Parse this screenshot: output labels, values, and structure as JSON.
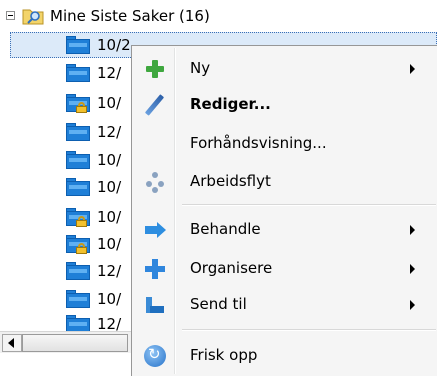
{
  "tree": {
    "root_label": "Mine Siste Saker (16)",
    "rows": [
      {
        "label": "10/2",
        "locked": false,
        "selected": true
      },
      {
        "label": "12/",
        "locked": false
      },
      {
        "label": "10/",
        "locked": true
      },
      {
        "label": "12/",
        "locked": false
      },
      {
        "label": "10/",
        "locked": false
      },
      {
        "label": "10/",
        "locked": false
      },
      {
        "label": "10/",
        "locked": true
      },
      {
        "label": "10/",
        "locked": true
      },
      {
        "label": "12/",
        "locked": false
      },
      {
        "label": "10/",
        "locked": false
      },
      {
        "label": "12/",
        "locked": false
      }
    ]
  },
  "context_menu": {
    "items": [
      {
        "label": "Ny",
        "icon": "plus-icon",
        "submenu": true,
        "bold": false
      },
      {
        "label": "Rediger...",
        "icon": "pencil-icon",
        "submenu": false,
        "bold": true
      },
      {
        "label": "Forhåndsvisning...",
        "icon": "",
        "submenu": false,
        "bold": false
      },
      {
        "label": "Arbeidsflyt",
        "icon": "workflow-icon",
        "submenu": false,
        "bold": false
      },
      {
        "label": "Behandle",
        "icon": "arrow-right-icon",
        "submenu": true,
        "bold": false
      },
      {
        "label": "Organisere",
        "icon": "move-arrows-icon",
        "submenu": true,
        "bold": false
      },
      {
        "label": "Send til",
        "icon": "send-to-icon",
        "submenu": true,
        "bold": false
      },
      {
        "label": "Frisk opp",
        "icon": "refresh-icon",
        "submenu": false,
        "bold": false
      }
    ]
  },
  "colors": {
    "selection": "#dceaf9",
    "folder": "#1f7fd7",
    "menu_background": "#f5f5f5"
  }
}
